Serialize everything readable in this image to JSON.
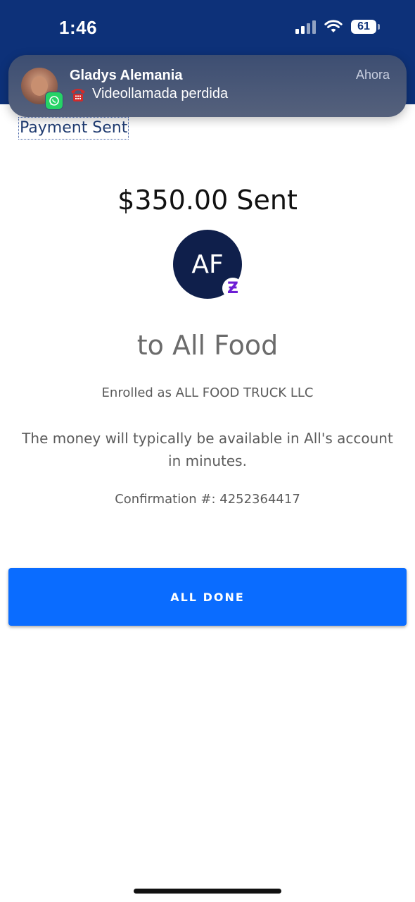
{
  "status_bar": {
    "time": "1:46",
    "battery": "61",
    "icons": [
      "cellular-signal-icon",
      "wifi-icon",
      "battery-icon"
    ]
  },
  "notification": {
    "sender": "Gladys Alemania",
    "message": "Videollamada perdida",
    "time": "Ahora",
    "app_icon": "whatsapp-icon",
    "message_icon": "telephone-icon"
  },
  "page": {
    "label": "Payment Sent"
  },
  "payment": {
    "amount_text": "$350.00 Sent",
    "avatar_initials": "AF",
    "badge_symbol": "Ƶ",
    "recipient_text": "to All Food",
    "enrolled_text": "Enrolled as ALL FOOD TRUCK LLC",
    "info_text": "The money will typically be available in All's account in minutes.",
    "confirmation_text": "Confirmation #: 4252364417"
  },
  "actions": {
    "done_label": "ALL DONE"
  },
  "colors": {
    "header_bg": "#0d3179",
    "button_bg": "#0a6cff",
    "avatar_bg": "#0f1f4b",
    "zelle_purple": "#6d1ed4"
  }
}
